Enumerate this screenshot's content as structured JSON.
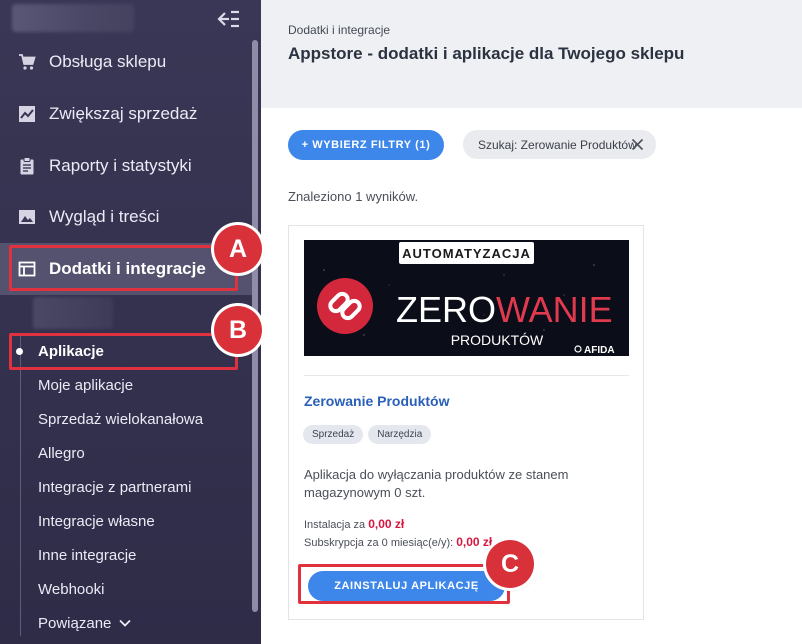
{
  "sidebar": {
    "items": [
      {
        "label": "Obsługa sklepu",
        "icon": "cart-icon"
      },
      {
        "label": "Zwiększaj sprzedaż",
        "icon": "trend-chart-icon"
      },
      {
        "label": "Raporty i statystyki",
        "icon": "clipboard-icon"
      },
      {
        "label": "Wygląd i treści",
        "icon": "image-icon"
      },
      {
        "label": "Dodatki i integracje",
        "icon": "window-icon"
      }
    ],
    "sub_items": [
      {
        "label": "Aplikacje"
      },
      {
        "label": "Moje aplikacje"
      },
      {
        "label": "Sprzedaż wielokanałowa"
      },
      {
        "label": "Allegro"
      },
      {
        "label": "Integracje z partnerami"
      },
      {
        "label": "Integracje własne"
      },
      {
        "label": "Inne integracje"
      },
      {
        "label": "Webhooki"
      },
      {
        "label": "Powiązane"
      }
    ]
  },
  "header": {
    "breadcrumb": "Dodatki i integracje",
    "title": "Appstore - dodatki i aplikacje dla Twojego sklepu"
  },
  "filters": {
    "button_label": "+ WYBIERZ FILTRY (1)",
    "search_chip": "Szukaj: Zerowanie Produktów"
  },
  "results_text": "Znaleziono 1 wyników.",
  "app_card": {
    "banner": {
      "badge": "AUTOMATYZACJA",
      "title_part1": "ZERO",
      "title_part2": "WANIE",
      "subtitle": "PRODUKTÓW",
      "brand": "AFIDA"
    },
    "name": "Zerowanie Produktów",
    "tags": [
      "Sprzedaż",
      "Narzędzia"
    ],
    "description": "Aplikacja do wyłączania produktów ze stanem magazynowym 0 szt.",
    "install_price_label": "Instalacja za",
    "install_price": "0,00 zł",
    "subscription_label": "Subskrypcja za 0 miesiąc(e/y):",
    "subscription_price": "0,00 zł",
    "install_button": "ZAINSTALUJ APLIKACJĘ"
  },
  "annotations": {
    "a": "A",
    "b": "B",
    "c": "C"
  },
  "colors": {
    "sidebar_bg": "#34324f",
    "accent_blue": "#3d86ea",
    "price_red": "#d8153e",
    "annotation_red": "#d9313a"
  }
}
